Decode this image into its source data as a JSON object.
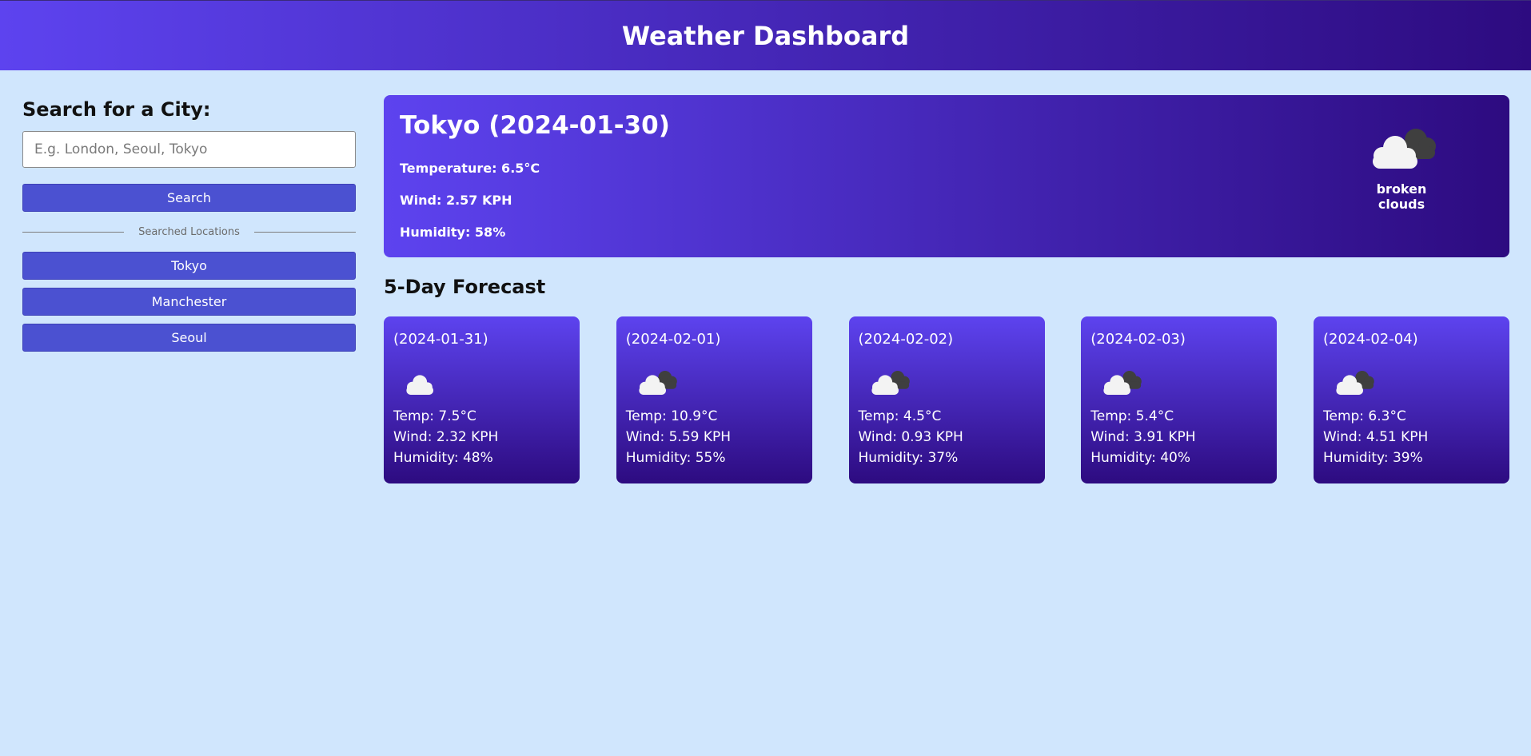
{
  "header": {
    "title": "Weather Dashboard"
  },
  "sidebar": {
    "heading": "Search for a City:",
    "search_placeholder": "E.g. London, Seoul, Tokyo",
    "search_value": "",
    "search_button": "Search",
    "divider_label": "Searched Locations",
    "history": [
      "Tokyo",
      "Manchester",
      "Seoul"
    ]
  },
  "current": {
    "title": "Tokyo (2024-01-30)",
    "temperature": "Temperature: 6.5°C",
    "wind": "Wind: 2.57 KPH",
    "humidity": "Humidity: 58%",
    "description": "broken clouds",
    "icon": "broken-clouds-icon"
  },
  "forecast": {
    "title": "5-Day Forecast",
    "days": [
      {
        "date": "(2024-01-31)",
        "temp": "Temp: 7.5°C",
        "wind": "Wind: 2.32 KPH",
        "humidity": "Humidity: 48%",
        "icon": "cloud-icon"
      },
      {
        "date": "(2024-02-01)",
        "temp": "Temp: 10.9°C",
        "wind": "Wind: 5.59 KPH",
        "humidity": "Humidity: 55%",
        "icon": "broken-clouds-icon"
      },
      {
        "date": "(2024-02-02)",
        "temp": "Temp: 4.5°C",
        "wind": "Wind: 0.93 KPH",
        "humidity": "Humidity: 37%",
        "icon": "broken-clouds-icon"
      },
      {
        "date": "(2024-02-03)",
        "temp": "Temp: 5.4°C",
        "wind": "Wind: 3.91 KPH",
        "humidity": "Humidity: 40%",
        "icon": "broken-clouds-icon"
      },
      {
        "date": "(2024-02-04)",
        "temp": "Temp: 6.3°C",
        "wind": "Wind: 4.51 KPH",
        "humidity": "Humidity: 39%",
        "icon": "broken-clouds-icon"
      }
    ]
  },
  "colors": {
    "background": "#d0e6fd",
    "gradient_start": "#5d43ef",
    "gradient_end": "#2d0b80",
    "button": "#4b51d1"
  }
}
